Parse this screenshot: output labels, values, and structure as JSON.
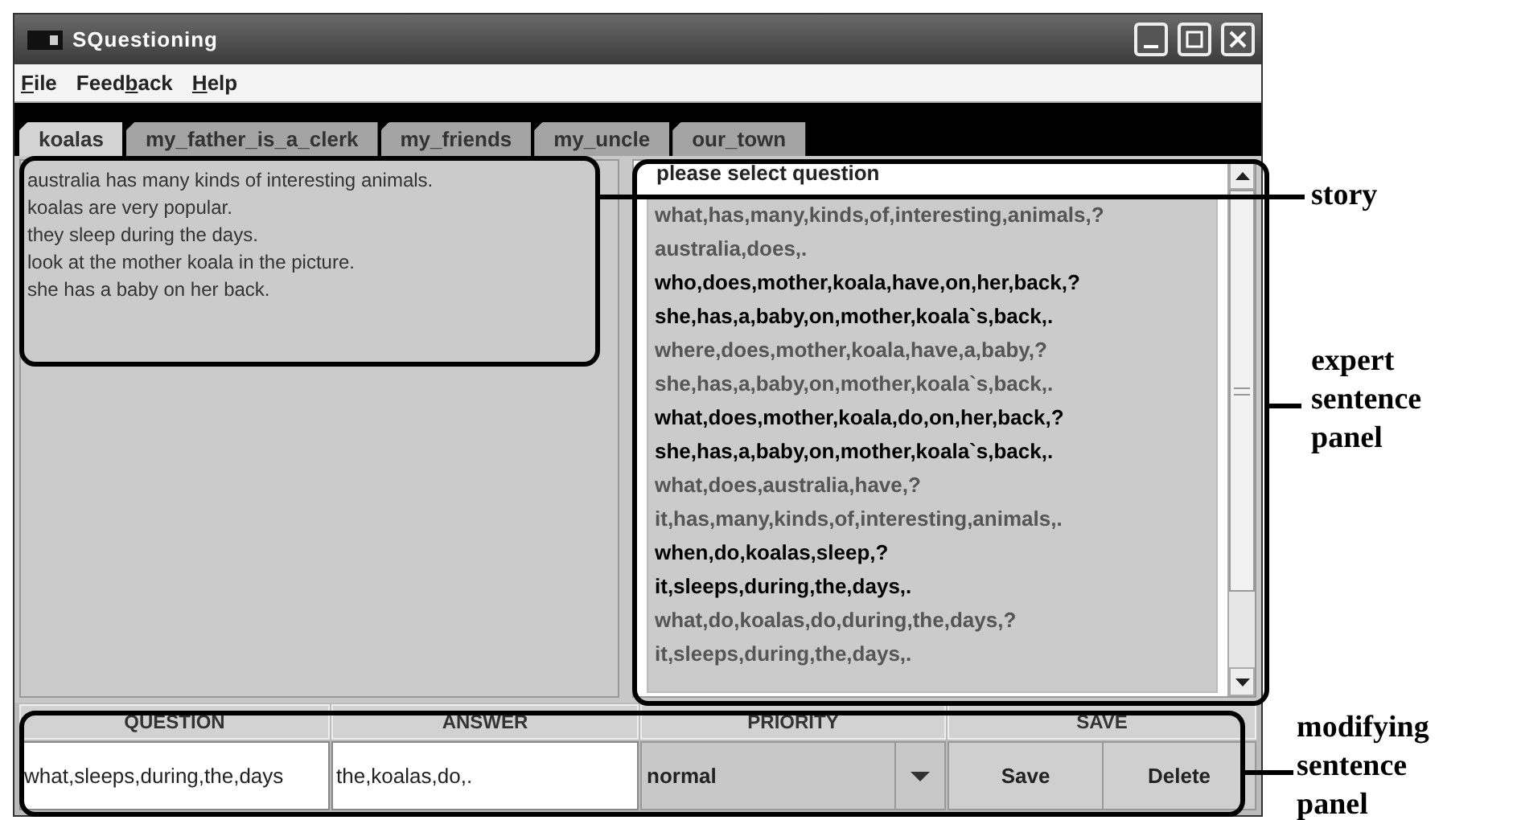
{
  "window": {
    "title": "SQuestioning"
  },
  "menu": [
    {
      "key": "F",
      "after": "ile"
    },
    {
      "before": "Feed",
      "key": "b",
      "after": "ack"
    },
    {
      "key": "H",
      "after": "elp"
    }
  ],
  "tabs": [
    {
      "label": "koalas",
      "selected": true
    },
    {
      "label": "my_father_is_a_clerk",
      "selected": false
    },
    {
      "label": "my_friends",
      "selected": false
    },
    {
      "label": "my_uncle",
      "selected": false
    },
    {
      "label": "our_town",
      "selected": false
    }
  ],
  "story": [
    "australia has many kinds of interesting animals.",
    "koalas are very popular.",
    "they sleep during the days.",
    "look at the mother koala in the picture.",
    "she has a baby on her back."
  ],
  "question_list": {
    "title": "please select question",
    "items": [
      {
        "text": "what,has,many,kinds,of,interesting,animals,?",
        "highlighted": false
      },
      {
        "text": "australia,does,.",
        "highlighted": false
      },
      {
        "text": "who,does,mother,koala,have,on,her,back,?",
        "highlighted": true
      },
      {
        "text": "she,has,a,baby,on,mother,koala`s,back,.",
        "highlighted": true
      },
      {
        "text": "where,does,mother,koala,have,a,baby,?",
        "highlighted": false
      },
      {
        "text": "she,has,a,baby,on,mother,koala`s,back,.",
        "highlighted": false
      },
      {
        "text": "what,does,mother,koala,do,on,her,back,?",
        "highlighted": true
      },
      {
        "text": "she,has,a,baby,on,mother,koala`s,back,.",
        "highlighted": true
      },
      {
        "text": "what,does,australia,have,?",
        "highlighted": false
      },
      {
        "text": "it,has,many,kinds,of,interesting,animals,.",
        "highlighted": false
      },
      {
        "text": "when,do,koalas,sleep,?",
        "highlighted": true
      },
      {
        "text": "it,sleeps,during,the,days,.",
        "highlighted": true
      },
      {
        "text": "what,do,koalas,do,during,the,days,?",
        "highlighted": false
      },
      {
        "text": "it,sleeps,during,the,days,.",
        "highlighted": false
      }
    ]
  },
  "editor": {
    "columns": [
      "QUESTION",
      "ANSWER",
      "PRIORITY",
      "SAVE"
    ],
    "question": "what,sleeps,during,the,days",
    "answer": "the,koalas,do,.",
    "priority": "normal",
    "buttons": [
      "Save",
      "Delete"
    ]
  },
  "annotations": [
    {
      "kind": "story",
      "lines": [
        "story"
      ]
    },
    {
      "kind": "expert",
      "lines": [
        "expert",
        "sentence",
        "panel"
      ]
    },
    {
      "kind": "modifying",
      "lines": [
        "modifying",
        "sentence",
        "panel"
      ]
    }
  ]
}
